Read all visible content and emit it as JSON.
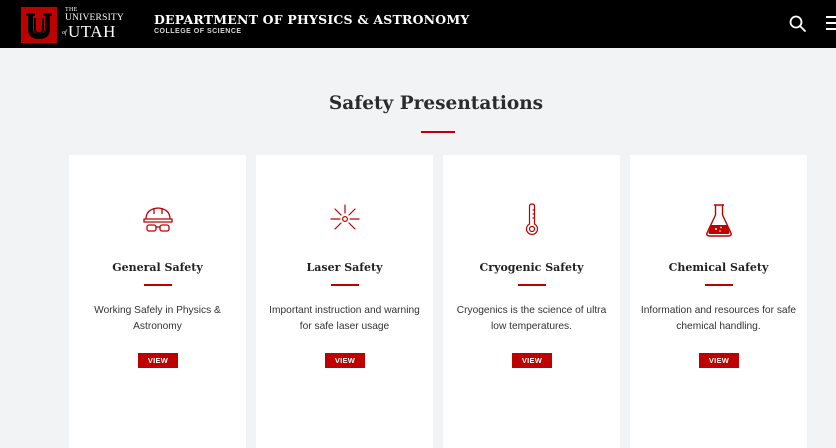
{
  "header": {
    "logo_the": "THE",
    "logo_university": "UNIVERSITY",
    "logo_of": "of",
    "logo_utah": "UTAH",
    "department": "DEPARTMENT OF PHYSICS & ASTRONOMY",
    "college": "COLLEGE OF SCIENCE",
    "search_icon": "search-icon",
    "menu_icon": "menu-icon"
  },
  "main": {
    "title": "Safety Presentations",
    "accent_color": "#be0000",
    "cards": [
      {
        "icon": "hard-hat-icon",
        "title": "General Safety",
        "description": "Working Safely in Physics & Astronomy",
        "button": "VIEW"
      },
      {
        "icon": "laser-icon",
        "title": "Laser Safety",
        "description": "Important instruction and warning for safe laser usage",
        "button": "VIEW"
      },
      {
        "icon": "thermometer-icon",
        "title": "Cryogenic Safety",
        "description": "Cryogenics is the science of ultra low temperatures.",
        "button": "VIEW"
      },
      {
        "icon": "flask-icon",
        "title": "Chemical Safety",
        "description": "Information and resources for safe chemical handling.",
        "button": "VIEW"
      }
    ]
  }
}
